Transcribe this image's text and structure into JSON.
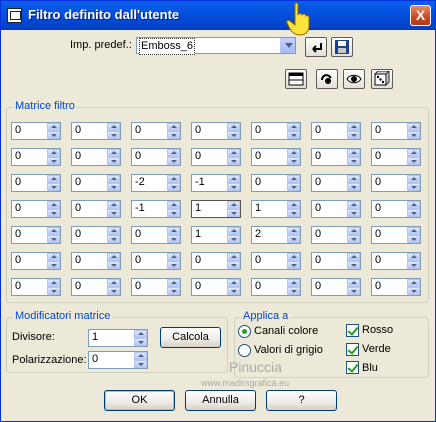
{
  "window": {
    "title": "Filtro definito dall'utente",
    "close_label": "X"
  },
  "preset": {
    "label": "Imp. predef.:",
    "value": "Emboss_6"
  },
  "matrix": {
    "label": "Matrice filtro",
    "rows": [
      [
        "0",
        "0",
        "0",
        "0",
        "0",
        "0",
        "0"
      ],
      [
        "0",
        "0",
        "0",
        "0",
        "0",
        "0",
        "0"
      ],
      [
        "0",
        "0",
        "-2",
        "-1",
        "0",
        "0",
        "0"
      ],
      [
        "0",
        "0",
        "-1",
        "1",
        "1",
        "0",
        "0"
      ],
      [
        "0",
        "0",
        "0",
        "1",
        "2",
        "0",
        "0"
      ],
      [
        "0",
        "0",
        "0",
        "0",
        "0",
        "0",
        "0"
      ],
      [
        "0",
        "0",
        "0",
        "0",
        "0",
        "0",
        "0"
      ]
    ]
  },
  "modifiers": {
    "label": "Modificatori matrice",
    "divisor_label": "Divisore:",
    "divisor_value": "1",
    "calc_label": "Calcola",
    "bias_label": "Polarizzazione:",
    "bias_value": "0"
  },
  "apply": {
    "label": "Applica a",
    "color_channels": "Canali colore",
    "gray_values": "Valori di grigio",
    "red": "Rosso",
    "green": "Verde",
    "blue": "Blu"
  },
  "buttons": {
    "ok": "OK",
    "cancel": "Annulla",
    "help": "?"
  },
  "watermark": {
    "name": "Pinuccia",
    "url": "www.madirsgrafica.eu"
  }
}
